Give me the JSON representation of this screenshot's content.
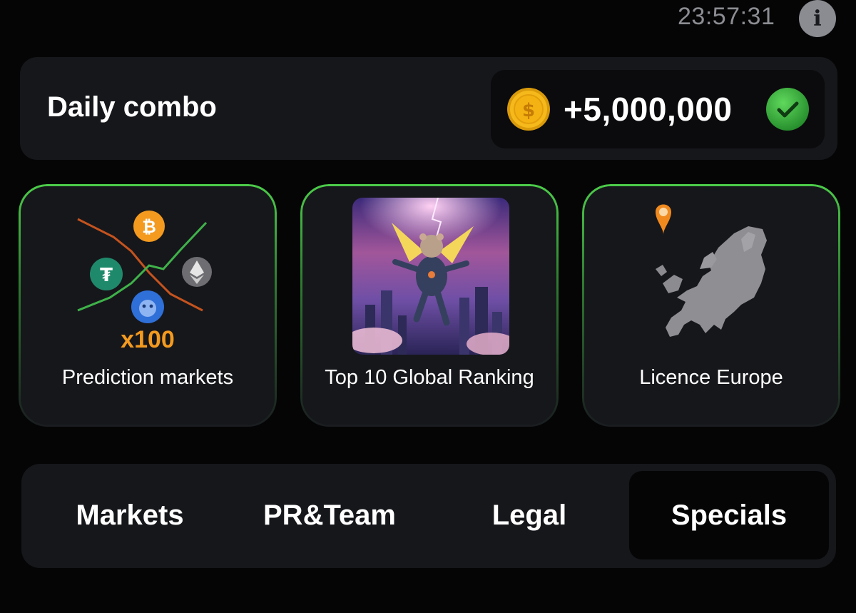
{
  "header": {
    "timer": "23:57:31",
    "info_icon": "info-icon"
  },
  "combo": {
    "title": "Daily combo",
    "reward": "+5,000,000",
    "coin_icon": "coin-icon",
    "status_icon": "check-icon",
    "coin_color": "#f4b312",
    "check_color": "#35b33a"
  },
  "cards": [
    {
      "label": "Prediction markets",
      "badge": "x100",
      "art": "crypto-chart-art"
    },
    {
      "label": "Top 10 Global Ranking",
      "art": "flying-hamster-city-art"
    },
    {
      "label": "Licence Europe",
      "art": "europe-map-art"
    }
  ],
  "tabs": {
    "items": [
      "Markets",
      "PR&Team",
      "Legal",
      "Specials"
    ],
    "active": "Specials"
  },
  "colors": {
    "accent_green": "#4dcc4a",
    "orange": "#f39a1f",
    "card_bg": "#16171b",
    "page_bg": "#050506"
  }
}
